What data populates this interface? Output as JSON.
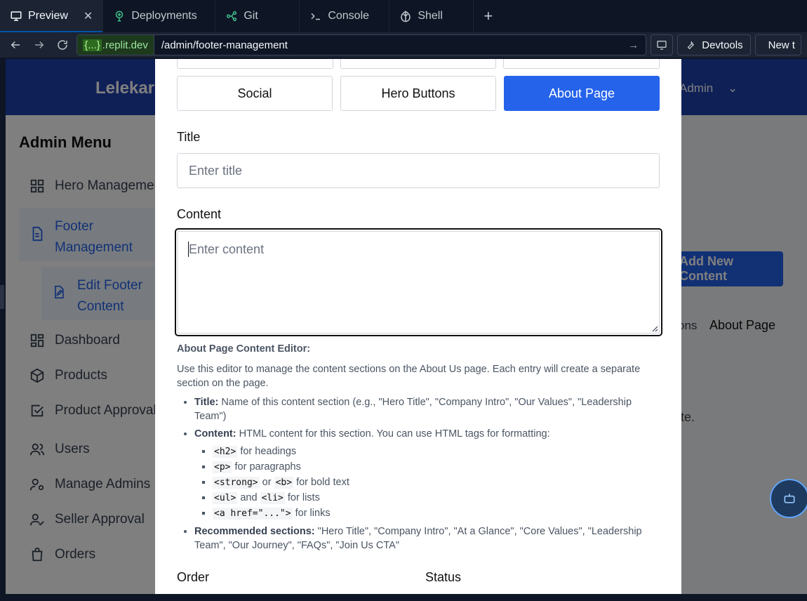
{
  "chrome": {
    "tabs": [
      {
        "label": "Preview",
        "icon": "monitor-icon"
      },
      {
        "label": "Deployments",
        "icon": "deploy-icon"
      },
      {
        "label": "Git",
        "icon": "git-icon"
      },
      {
        "label": "Console",
        "icon": "terminal-icon"
      },
      {
        "label": "Shell",
        "icon": "shell-icon"
      }
    ],
    "close_glyph": "✕",
    "add_glyph": "+",
    "url_host_brace": "{...}",
    "url_host": ".replit.dev",
    "url_path": "/admin/footer-management",
    "devtools_label": "Devtools",
    "newtab_label": "New t"
  },
  "background": {
    "brand": "Lelekar",
    "admin_link": "Admin",
    "sidebar_title": "Admin Menu",
    "sidebar_items": [
      {
        "label": "Hero Management",
        "icon": "grid-icon"
      },
      {
        "label": "Footer Management",
        "icon": "file-icon"
      },
      {
        "label": "Edit Footer Content",
        "icon": "file-edit-icon"
      },
      {
        "label": "Dashboard",
        "icon": "grid-icon"
      },
      {
        "label": "Products",
        "icon": "box-icon"
      },
      {
        "label": "Product Approval",
        "icon": "check-square-icon"
      },
      {
        "label": "Users",
        "icon": "users-icon"
      },
      {
        "label": "Manage Admins",
        "icon": "user-cog-icon"
      },
      {
        "label": "Seller Approval",
        "icon": "user-check-icon"
      },
      {
        "label": "Orders",
        "icon": "bag-icon"
      }
    ],
    "add_button": "Add New Content",
    "filter_fragment": "ons",
    "filter_chip": "About Page",
    "bg_fragment": "te."
  },
  "modal": {
    "category_tabs": [
      "Social",
      "Hero Buttons",
      "About Page"
    ],
    "active_tab": "About Page",
    "title_label": "Title",
    "title_placeholder": "Enter title",
    "content_label": "Content",
    "content_placeholder": "Enter content",
    "help": {
      "heading": "About Page Content Editor:",
      "intro": "Use this editor to manage the content sections on the About Us page. Each entry will create a separate section on the page.",
      "title_term": "Title:",
      "title_desc": " Name of this content section (e.g., \"Hero Title\", \"Company Intro\", \"Our Values\", \"Leadership Team\")",
      "content_term": "Content:",
      "content_desc": " HTML content for this section. You can use HTML tags for formatting:",
      "tags": [
        {
          "code1": "<h2>",
          "mid": "",
          "code2": "",
          "text": " for headings"
        },
        {
          "code1": "<p>",
          "mid": "",
          "code2": "",
          "text": " for paragraphs"
        },
        {
          "code1": "<strong>",
          "mid": " or ",
          "code2": "<b>",
          "text": " for bold text"
        },
        {
          "code1": "<ul>",
          "mid": " and ",
          "code2": "<li>",
          "text": " for lists"
        },
        {
          "code1": "<a href=\"...\">",
          "mid": "",
          "code2": "",
          "text": " for links"
        }
      ],
      "rec_term": "Recommended sections:",
      "rec_desc": " \"Hero Title\", \"Company Intro\", \"At a Glance\", \"Core Values\", \"Leadership Team\", \"Our Journey\", \"FAQs\", \"Join Us CTA\""
    },
    "order_label": "Order",
    "status_label": "Status"
  },
  "colors": {
    "accent": "#2563eb",
    "nav": "#1e40af",
    "chrome_bg": "#0e1525"
  }
}
